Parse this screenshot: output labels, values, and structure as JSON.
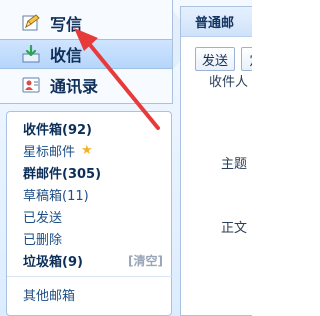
{
  "sidebar": {
    "items": [
      {
        "label": "写信",
        "icon": "pencil-icon"
      },
      {
        "label": "收信",
        "icon": "inbox-icon"
      },
      {
        "label": "通讯录",
        "icon": "contacts-icon"
      }
    ]
  },
  "folders": {
    "items": [
      {
        "label": "收件箱(92)"
      },
      {
        "label": "星标邮件"
      },
      {
        "label": "群邮件(305)"
      },
      {
        "label": "草稿箱(11)"
      },
      {
        "label": "已发送"
      },
      {
        "label": "已删除"
      },
      {
        "label": "垃圾箱(9)"
      },
      {
        "label": "其他邮箱"
      }
    ],
    "clear_label": "[清空]"
  },
  "compose": {
    "header": "普通邮",
    "send_label": "发送",
    "save_label": "定",
    "fields": {
      "to_label": "收件人",
      "subject_label": "主题",
      "body_label": "正文"
    }
  },
  "colors": {
    "accent": "#1f4f86",
    "arrow": "#e73a3a",
    "star": "#f2b51f"
  }
}
